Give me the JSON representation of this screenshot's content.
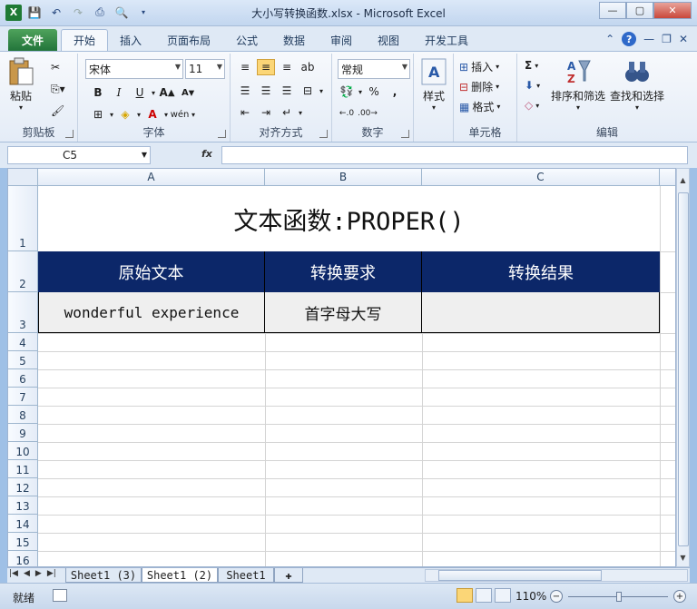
{
  "window": {
    "title": "大小写转换函数.xlsx - Microsoft Excel"
  },
  "ribbon_tabs": [
    "文件",
    "开始",
    "插入",
    "页面布局",
    "公式",
    "数据",
    "审阅",
    "视图",
    "开发工具"
  ],
  "ribbon": {
    "clipboard": {
      "paste": "粘贴",
      "label": "剪贴板"
    },
    "font": {
      "name": "宋体",
      "size": "11",
      "label": "字体"
    },
    "alignment": {
      "label": "对齐方式"
    },
    "number": {
      "format": "常规",
      "label": "数字"
    },
    "styles": {
      "button": "样式"
    },
    "cells": {
      "insert": "插入",
      "delete": "删除",
      "format": "格式",
      "label": "单元格"
    },
    "editing": {
      "sort": "排序和筛选",
      "find": "查找和选择",
      "label": "编辑"
    }
  },
  "formula_bar": {
    "name_box": "C5",
    "fx": "fx",
    "value": ""
  },
  "grid": {
    "columns": [
      "A",
      "B",
      "C"
    ],
    "rows": [
      "1",
      "2",
      "3",
      "4",
      "5",
      "6",
      "7",
      "8",
      "9",
      "10",
      "11",
      "12",
      "13",
      "14",
      "15",
      "16"
    ],
    "title": "文本函数:PROPER()",
    "headers": [
      "原始文本",
      "转换要求",
      "转换结果"
    ],
    "row3": [
      "wonderful experience",
      "首字母大写",
      ""
    ]
  },
  "sheet_tabs": [
    "Sheet1 (3)",
    "Sheet1 (2)",
    "Sheet1"
  ],
  "active_sheet": "Sheet1 (2)",
  "status": {
    "ready": "就绪",
    "zoom": "110%"
  },
  "colors": {
    "header_fill": "#0c2769",
    "data_fill": "#efefef",
    "file_tab": "#2e8b47"
  }
}
